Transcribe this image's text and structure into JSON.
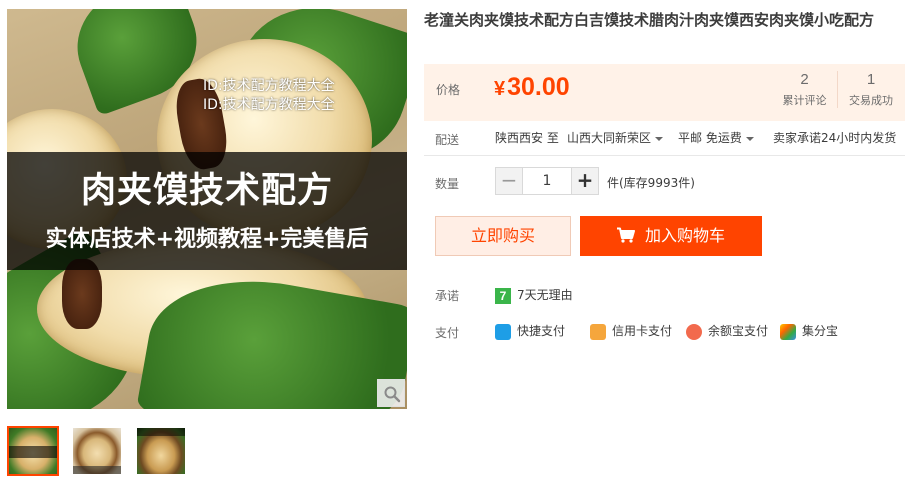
{
  "product": {
    "title": "老潼关肉夹馍技术配方白吉馍技术腊肉汁肉夹馍西安肉夹馍小吃配方",
    "image": {
      "watermark_1": "ID:技术配方教程大全",
      "watermark_2": "ID:技术配方教程大全",
      "banner_title": "肉夹馍技术配方",
      "banner_subtitle": "实体店技术+视频教程+完美售后"
    },
    "zoom_icon": "magnifier-icon",
    "thumbnails": [
      "thumbnail-1",
      "thumbnail-2",
      "thumbnail-3"
    ]
  },
  "price": {
    "label": "价格",
    "currency": "¥",
    "value": "30.00"
  },
  "stats": {
    "reviews_count": "2",
    "reviews_label": "累计评论",
    "deals_count": "1",
    "deals_label": "交易成功"
  },
  "shipping": {
    "label": "配送",
    "from": "陕西西安 至",
    "to": "山西大同新荣区",
    "method": "平邮 免运费",
    "promise": "卖家承诺24小时内发货"
  },
  "quantity": {
    "label": "数量",
    "minus": "−",
    "value": "1",
    "plus": "+",
    "stock": "件(库存9993件)"
  },
  "actions": {
    "buy_now": "立即购买",
    "add_to_cart": "加入购物车"
  },
  "promise": {
    "label": "承诺",
    "badge": "7",
    "text": "7天无理由"
  },
  "payment": {
    "label": "支付",
    "methods": [
      {
        "label": "快捷支付",
        "icon": "alipay-quick-icon",
        "color": "#1e9ee6"
      },
      {
        "label": "信用卡支付",
        "icon": "credit-card-icon",
        "color": "#f5a63c"
      },
      {
        "label": "余额宝支付",
        "icon": "yuebao-icon",
        "color": "#f26a4d"
      },
      {
        "label": "集分宝",
        "icon": "jifenbao-icon",
        "color": "#3a8ee6"
      }
    ]
  },
  "colors": {
    "accent": "#ff4400",
    "price_bg": "#fff2e8"
  }
}
